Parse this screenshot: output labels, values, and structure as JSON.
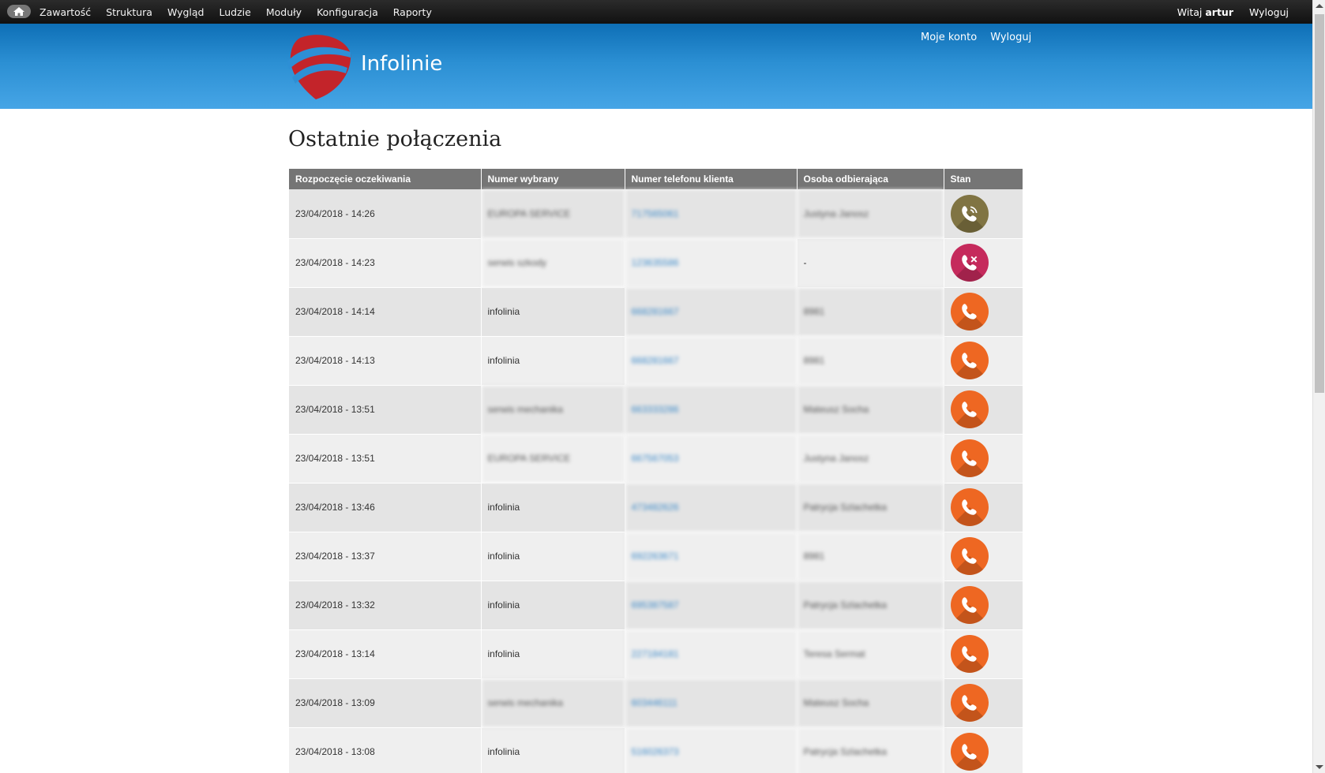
{
  "toolbar": {
    "menu": [
      "Zawartość",
      "Struktura",
      "Wygląd",
      "Ludzie",
      "Moduły",
      "Konfiguracja",
      "Raporty"
    ],
    "welcome_prefix": "Witaj",
    "username": "artur",
    "logout": "Wyloguj"
  },
  "header": {
    "site_name": "Infolinie",
    "secondary_menu": [
      "Moje konto",
      "Wyloguj"
    ]
  },
  "page": {
    "title": "Ostatnie połączenia"
  },
  "table": {
    "columns": [
      "Rozpoczęcie oczekiwania",
      "Numer wybrany",
      "Numer telefonu klienta",
      "Osoba odbierająca",
      "Stan"
    ],
    "rows": [
      {
        "start": "23/04/2018 - 14:26",
        "dialed": "EUROPA SERVICE",
        "phone": "717565061",
        "agent": "Justyna Janosz",
        "status": "answered"
      },
      {
        "start": "23/04/2018 - 14:23",
        "dialed": "serwis szkody",
        "phone": "123635586",
        "agent": "-",
        "status": "missed"
      },
      {
        "start": "23/04/2018 - 14:14",
        "dialed": "infolinia",
        "phone": "668281667",
        "agent": "8981",
        "status": "call"
      },
      {
        "start": "23/04/2018 - 14:13",
        "dialed": "infolinia",
        "phone": "668281667",
        "agent": "8981",
        "status": "call"
      },
      {
        "start": "23/04/2018 - 13:51",
        "dialed": "serwis mechanika",
        "phone": "663333286",
        "agent": "Mateusz Socha",
        "status": "call"
      },
      {
        "start": "23/04/2018 - 13:51",
        "dialed": "EUROPA SERVICE",
        "phone": "667567053",
        "agent": "Justyna Janosz",
        "status": "call"
      },
      {
        "start": "23/04/2018 - 13:46",
        "dialed": "infolinia",
        "phone": "473482626",
        "agent": "Patrycja Szlachetka",
        "status": "call"
      },
      {
        "start": "23/04/2018 - 13:37",
        "dialed": "infolinia",
        "phone": "692263671",
        "agent": "8981",
        "status": "call"
      },
      {
        "start": "23/04/2018 - 13:32",
        "dialed": "infolinia",
        "phone": "695387587",
        "agent": "Patrycja Szlachetka",
        "status": "call"
      },
      {
        "start": "23/04/2018 - 13:14",
        "dialed": "infolinia",
        "phone": "227184181",
        "agent": "Teresa Sermat",
        "status": "call"
      },
      {
        "start": "23/04/2018 - 13:09",
        "dialed": "serwis mechanika",
        "phone": "603446111",
        "agent": "Mateusz Socha",
        "status": "call"
      },
      {
        "start": "23/04/2018 - 13:08",
        "dialed": "infolinia",
        "phone": "516026373",
        "agent": "Patrycja Szlachetka",
        "status": "call"
      }
    ]
  },
  "colors": {
    "answered": "#807443",
    "missed": "#c52a5c",
    "call": "#ee6722",
    "header_blue": "#2b8fd3"
  },
  "icons": {
    "home": "home-icon",
    "answered": "phone-ringing-icon",
    "missed": "phone-missed-icon",
    "call": "phone-icon"
  }
}
